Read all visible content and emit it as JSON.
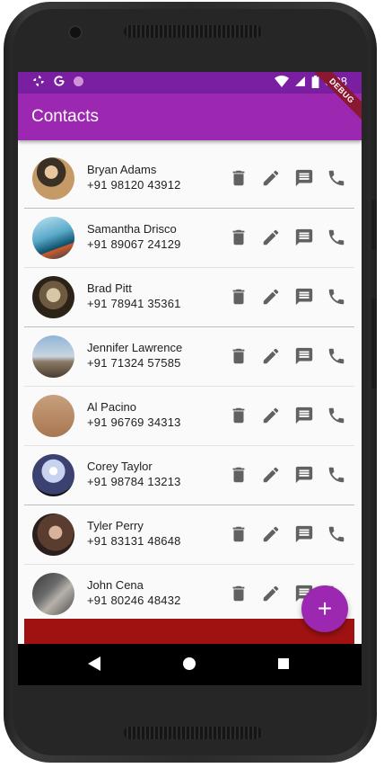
{
  "status_bar": {
    "time": "6:08",
    "icons": [
      "pinwheel-icon",
      "google-g-icon",
      "circle-icon",
      "wifi-icon",
      "signal-icon",
      "battery-icon"
    ]
  },
  "app_bar": {
    "title": "Contacts",
    "debug_banner": "DEBUG"
  },
  "colors": {
    "app_bar": "#9c27b0",
    "status_bar": "#7b1fa2",
    "fab": "#9c27b0",
    "delete_bar": "#a01212",
    "icon": "#616161"
  },
  "contacts": [
    {
      "name": "Bryan Adams",
      "phone": "+91 98120 43912"
    },
    {
      "name": "Samantha Drisco",
      "phone": "+91 89067 24129"
    },
    {
      "name": "Brad Pitt",
      "phone": "+91 78941 35361"
    },
    {
      "name": "Jennifer Lawrence",
      "phone": "+91 71324 57585"
    },
    {
      "name": "Al Pacino",
      "phone": "+91 96769 34313"
    },
    {
      "name": "Corey Taylor",
      "phone": "+91 98784 13213"
    },
    {
      "name": "Tyler Perry",
      "phone": "+91 83131 48648"
    },
    {
      "name": "John Cena",
      "phone": "+91 80246 48432"
    }
  ],
  "row_actions": [
    "delete-icon",
    "edit-icon",
    "message-icon",
    "call-icon"
  ],
  "fab": {
    "label": "+"
  },
  "nav_bar": {
    "buttons": [
      "back-icon",
      "home-icon",
      "recents-icon"
    ]
  }
}
